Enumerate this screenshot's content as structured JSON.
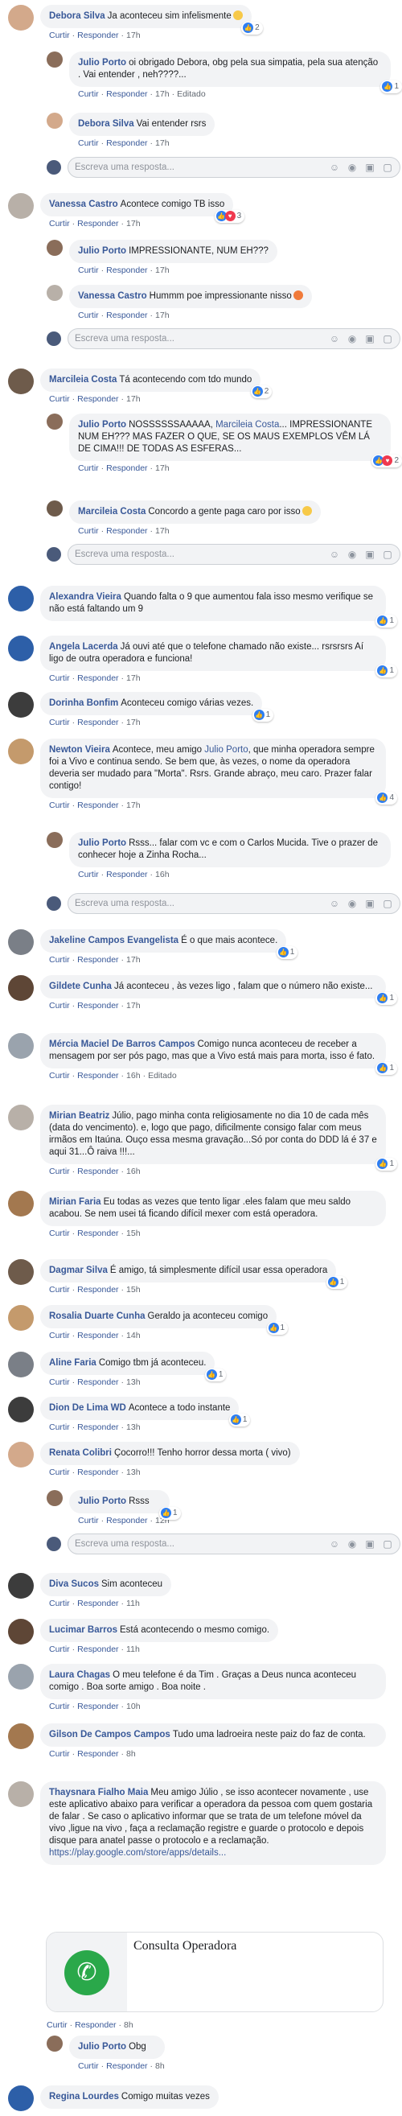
{
  "actions": {
    "reply": "Responder",
    "like": "Curtir",
    "edited": "Editado",
    "sep": "·"
  },
  "input": {
    "placeholder": "Escreva uma resposta..."
  },
  "comments": [
    {
      "author": "Debora Silva",
      "text": "Ja aconteceu sim infelismente",
      "time": "17h",
      "reacts": "2"
    },
    {
      "author": "Julio Porto",
      "text": "oi obrigado Debora, obg pela sua simpatia, pela sua atenção . Vai entender , neh????...",
      "time": "17h",
      "reacts": "1"
    },
    {
      "author": "Debora Silva",
      "text": "Vai entender rsrs",
      "time": "17h"
    },
    {
      "author": "Vanessa Castro",
      "text": "Acontece comigo TB isso",
      "time": "17h",
      "reacts": "3"
    },
    {
      "author": "Julio Porto",
      "text": "IMPRESSIONANTE, NUM EH???",
      "time": "17h"
    },
    {
      "author": "Vanessa Castro",
      "text": "Hummm poe impressionante nisso",
      "time": "17h"
    },
    {
      "author": "Marcileia Costa",
      "text": "Tá acontecendo com tdo mundo",
      "time": "17h",
      "reacts": "2"
    },
    {
      "author": "Julio Porto",
      "text_a": "NOSSSSSSAAAAA,",
      "mention": "Marcileia Costa",
      "text_b": "... IMPRESSIONANTE NUM EH??? MAS FAZER O QUE, SE OS MAUS EXEMPLOS VÊM LÁ DE CIMA!!! DE TODAS AS ESFERAS...",
      "time": "17h",
      "reacts": "2"
    },
    {
      "author": "Marcileia Costa",
      "text": "Concordo a gente paga caro por isso",
      "time": "17h"
    },
    {
      "author": "Alexandra Vieira",
      "text": "Quando falta o 9 que aumentou fala isso mesmo verifique se não está faltando um 9",
      "time": "17h",
      "reacts": "1"
    },
    {
      "author": "Angela Lacerda",
      "text": "Já ouvi até que o telefone chamado não existe... rsrsrsrs Aí ligo de outra operadora e funciona!",
      "time": "17h",
      "reacts": "1"
    },
    {
      "author": "Dorinha Bonfim",
      "text": "Aconteceu comigo várias vezes.",
      "time": "17h",
      "reacts": "1"
    },
    {
      "author": "Newton Vieira",
      "text_a": "Acontece, meu amigo",
      "mention": "Julio Porto",
      "text_b": ", que minha operadora sempre foi a Vivo e continua sendo. Se bem que, às vezes, o nome da operadora deveria ser mudado para \"Morta\". Rsrs. Grande abraço, meu caro. Prazer falar contigo!",
      "time": "17h",
      "reacts": "4"
    },
    {
      "author": "Julio Porto",
      "text": "Rsss... falar com vc e com o Carlos Mucida. Tive o prazer de conhecer hoje a Zinha Rocha...",
      "time": "16h"
    },
    {
      "author": "Jakeline Campos Evangelista",
      "text": "É o que mais acontece.",
      "time": "17h",
      "reacts": "1"
    },
    {
      "author": "Gildete Cunha",
      "text": "Já aconteceu , às vezes ligo , falam que o número não existe...",
      "time": "17h",
      "reacts": "1"
    },
    {
      "author": "Mércia Maciel De Barros Campos",
      "text": "Comigo nunca aconteceu de receber a mensagem por ser pós pago, mas que a Vivo está mais para morta, isso é fato.",
      "time": "16h",
      "reacts": "1"
    },
    {
      "author": "Mirian Beatriz",
      "text": "Júlio, pago minha conta religiosamente no dia 10 de cada mês (data do vencimento). e, logo que pago, dificilmente consigo falar com meus irmãos em Itaúna. Ouço essa mesma gravação...Só por conta do DDD lá é 37 e aqui 31...Ô raiva !!!...",
      "time": "16h",
      "reacts": "1"
    },
    {
      "author": "Mirian Faria",
      "text": "Eu todas as vezes que tento ligar .eles falam que meu saldo acabou. Se nem usei tá ficando difícil mexer com está operadora.",
      "time": "15h"
    },
    {
      "author": "Dagmar Silva",
      "text": "É amigo, tá simplesmente difícil usar essa operadora",
      "time": "15h",
      "reacts": "1"
    },
    {
      "author": "Rosalia Duarte Cunha",
      "text": "Geraldo ja aconteceu comigo",
      "time": "14h",
      "reacts": "1"
    },
    {
      "author": "Aline Faria",
      "text": "Comigo tbm já aconteceu.",
      "time": "13h",
      "reacts": "1"
    },
    {
      "author": "Dion De Lima WD",
      "text": "Acontece a todo instante",
      "time": "13h",
      "reacts": "1"
    },
    {
      "author": "Renata Colibri",
      "text": "Çocorro!!! Tenho horror dessa morta ( vivo)",
      "time": "13h"
    },
    {
      "author": "Julio Porto",
      "text": "Rsss",
      "time": "12h",
      "reacts": "1"
    },
    {
      "author": "Diva Sucos",
      "text": "Sim aconteceu",
      "time": "11h"
    },
    {
      "author": "Lucimar Barros",
      "text": "Está acontecendo o mesmo comigo.",
      "time": "11h"
    },
    {
      "author": "Laura Chagas",
      "text": "O meu telefone é da Tim . Graças a Deus nunca aconteceu comigo . Boa sorte amigo . Boa noite .",
      "time": "10h"
    },
    {
      "author": "Gilson De Campos Campos",
      "text": "Tudo uma ladroeira neste paiz do faz de conta.",
      "time": "8h"
    },
    {
      "author": "Thaysnara Fialho Maia",
      "text": "Meu amigo Júlio , se isso acontecer novamente , use este aplicativo abaixo para verificar a operadora da pessoa com quem gostaria de falar . Se caso o aplicativo informar que se trata de um telefone móvel da vivo ,ligue na vivo , faça a reclamação registre e guarde o protocolo e depois disque para anatel passe o protocolo e a reclamação.",
      "link": "https://play.google.com/store/apps/details...",
      "time": "8h"
    },
    {
      "author": "Julio Porto",
      "text": "Obg",
      "time": "8h"
    },
    {
      "author": "Regina Lourdes",
      "text": "Comigo muitas vezes",
      "time": ""
    }
  ],
  "card": {
    "title": "Consulta Operadora"
  },
  "icons": {
    "emoji": "smile-icon",
    "camera": "camera-icon",
    "gif": "gif-icon",
    "sticker": "sticker-icon"
  }
}
